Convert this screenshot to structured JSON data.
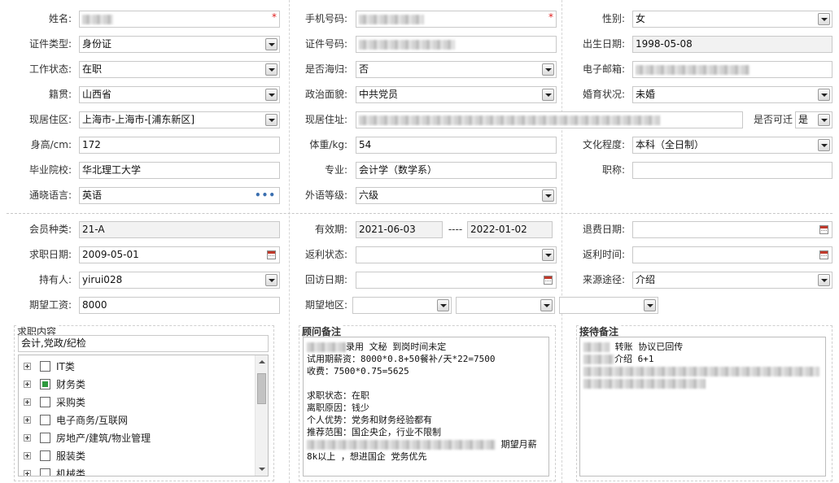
{
  "labels": {
    "name": "姓名:",
    "phone": "手机号码:",
    "gender": "性别:",
    "id_type": "证件类型:",
    "id_no": "证件号码:",
    "birth": "出生日期:",
    "work_status": "工作状态:",
    "returnee": "是否海归:",
    "email": "电子邮箱:",
    "native": "籍贯:",
    "political": "政治面貌:",
    "marital": "婚育状况:",
    "residence_area": "现居住区:",
    "address": "现居住址:",
    "relocate": "是否可迁",
    "height": "身高/cm:",
    "weight": "体重/kg:",
    "education": "文化程度:",
    "school": "毕业院校:",
    "major": "专业:",
    "title": "职称:",
    "language": "通晓语言:",
    "lang_level": "外语等级:",
    "member_type": "会员种类:",
    "valid": "有效期:",
    "refund_date": "退费日期:",
    "job_date": "求职日期:",
    "rebate_status": "返利状态:",
    "rebate_time": "返利时间:",
    "holder": "持有人:",
    "visit_date": "回访日期:",
    "source": "来源途径:",
    "salary": "期望工资:",
    "region": "期望地区:"
  },
  "values": {
    "gender": "女",
    "id_type": "身份证",
    "birth": "1998-05-08",
    "work_status": "在职",
    "returnee": "否",
    "native": "山西省",
    "political": "中共党员",
    "marital": "未婚",
    "residence_area": "上海市-上海市-[浦东新区]",
    "relocate": "是",
    "height": "172",
    "weight": "54",
    "education": "本科（全日制）",
    "school": "华北理工大学",
    "major": "会计学（数学系）",
    "title": "",
    "language": "英语",
    "lang_level": "六级",
    "member_type": "21-A",
    "valid_from": "2021-06-03",
    "valid_sep": "----",
    "valid_to": "2022-01-02",
    "refund_date": "",
    "job_date": "2009-05-01",
    "rebate_status": "",
    "rebate_time": "",
    "holder": "yirui028",
    "visit_date": "",
    "source": "介绍",
    "salary": "8000",
    "region1": "",
    "region2": "",
    "region3": ""
  },
  "job_section": {
    "title": "求职内容",
    "summary": "会计,党政/纪检",
    "tree": [
      {
        "label": "IT类",
        "state": "none"
      },
      {
        "label": "财务类",
        "state": "partial"
      },
      {
        "label": "采购类",
        "state": "none"
      },
      {
        "label": "电子商务/互联网",
        "state": "none"
      },
      {
        "label": "房地产/建筑/物业管理",
        "state": "none"
      },
      {
        "label": "服装类",
        "state": "none"
      },
      {
        "label": "机械类",
        "state": "none"
      }
    ]
  },
  "consultant": {
    "title": "顾问备注",
    "l1": "录用  文秘  到岗时间未定",
    "l2": "试用期薪资：8000*0.8+50餐补/天*22=7500",
    "l3": "收费：7500*0.75=5625",
    "l4": "求职状态：在职",
    "l5": "离职原因：钱少",
    "l6": "个人优势：党务和财务经验都有",
    "l7": "推荐范围：国企央企，行业不限制",
    "l8": "期望月薪",
    "l9": "8k以上 ，想进国企 党务优先"
  },
  "reception": {
    "title": "接待备注",
    "l1": "转账 协议已回传",
    "l2": "介绍  6+1"
  },
  "icons": {
    "dropdown": "chevron-down-icon",
    "calendar": "calendar-icon",
    "more": "more-dots-icon",
    "required": "required-asterisk-icon"
  },
  "colors": {
    "required": "#e02020",
    "readonly_bg": "#f2f2f2",
    "border": "#c9c9c9",
    "check_partial": "#2e9a3e",
    "dots": "#3a6fb0"
  }
}
